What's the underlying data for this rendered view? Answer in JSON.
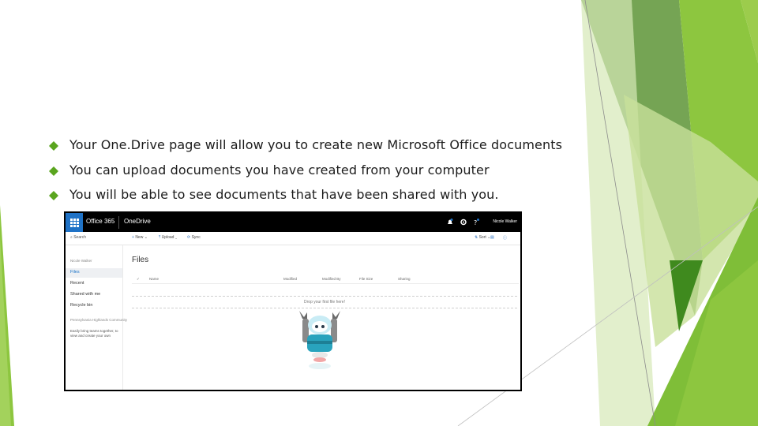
{
  "slide": {
    "bullets": [
      "Your One.Drive page will allow you to create new Microsoft Office documents",
      "You can upload documents you have created from your computer",
      "You will be able to see documents that have been shared with you."
    ],
    "bullet_color": "#5aa51f",
    "accent_colors": [
      "#8dc63f",
      "#5aa51f",
      "#3f8a1e",
      "#c8e09a",
      "#6e9f4b"
    ]
  },
  "screenshot": {
    "topbar": {
      "app_name": "Office 365",
      "service_name": "OneDrive",
      "user_name": "Nicole Walker",
      "waffle_color": "#1f72c6"
    },
    "command_bar": {
      "search_placeholder": "Search",
      "new_label": "New",
      "upload_label": "Upload",
      "sync_label": "Sync",
      "sort_label": "Sort"
    },
    "sidebar": {
      "owner": "Nicole Walker",
      "items": [
        "Files",
        "Recent",
        "Shared with me",
        "Recycle bin"
      ],
      "group_heading": "Pennsylvania Highlands Community",
      "group_note": "Easily bring teams together, to view and create your own"
    },
    "main": {
      "title": "Files",
      "columns": [
        "Name",
        "Modified",
        "Modified By",
        "File Size",
        "Sharing"
      ],
      "drop_text": "Drop your first file here!"
    }
  }
}
